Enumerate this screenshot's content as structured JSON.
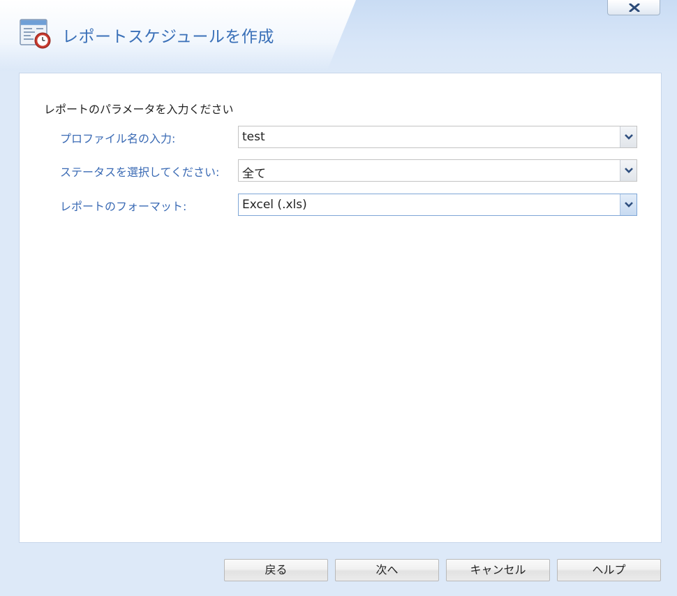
{
  "window": {
    "title": "レポートスケジュールを作成"
  },
  "form": {
    "instruction": "レポートのパラメータを入力ください",
    "fields": [
      {
        "label": "プロファイル名の入力:",
        "value": "test"
      },
      {
        "label": "ステータスを選択してください:",
        "value": "全て"
      },
      {
        "label": "レポートのフォーマット:",
        "value": "Excel (.xls)"
      }
    ]
  },
  "footer": {
    "back_label": "戻る",
    "next_label": "次へ",
    "cancel_label": "キャンセル",
    "help_label": "ヘルプ"
  },
  "icons": {
    "title": "report-schedule-calendar-clock-icon",
    "close": "close-x-icon",
    "dropdown": "chevron-down-icon"
  },
  "colors": {
    "accent_text": "#3a70b8",
    "label_text": "#3a6ab4",
    "background": "#dde9f8",
    "panel": "#ffffff",
    "active_border": "#7ea6d6"
  }
}
